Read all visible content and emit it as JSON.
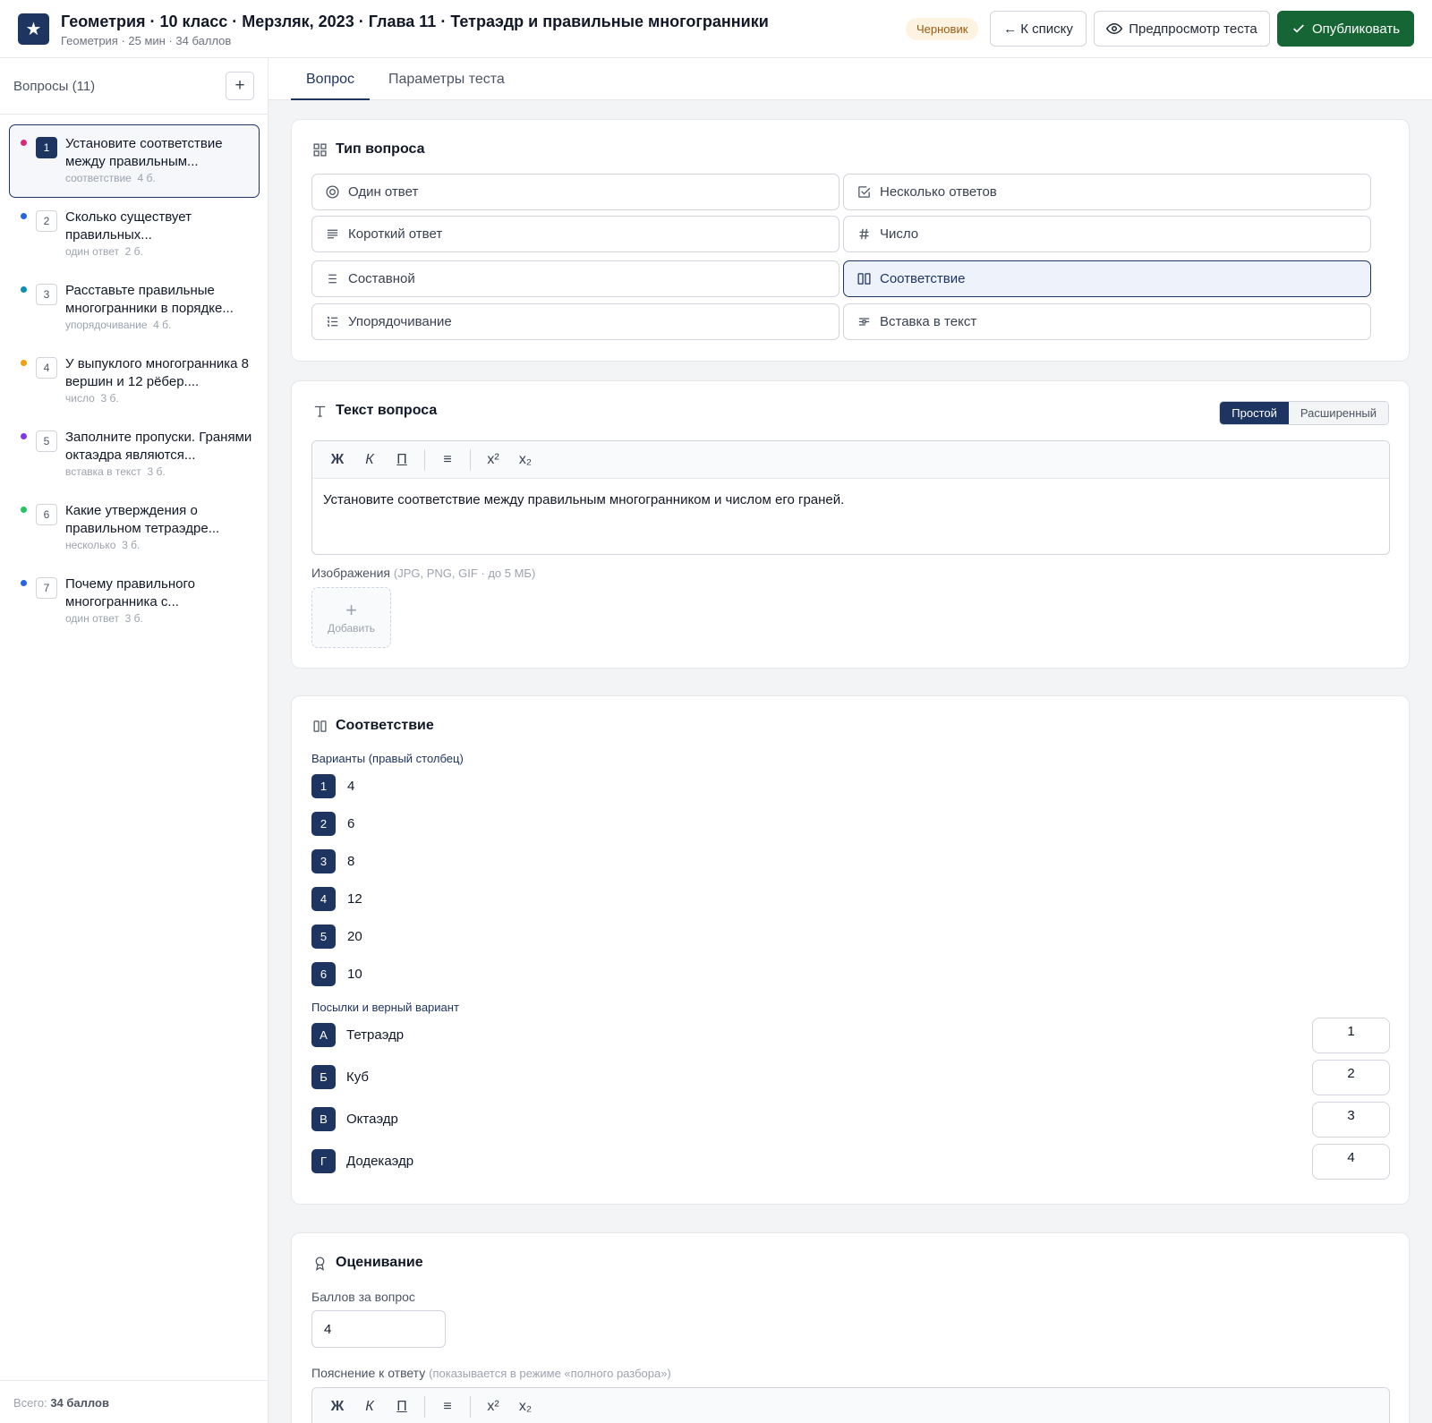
{
  "header": {
    "logo_glyph": "★",
    "title": "Геометрия · 10 класс · Мерзляк, 2023 · Глава 11 · Тетраэдр и правильные многогранники",
    "subtitle": "Геометрия · 25 мин · 34 баллов",
    "status_badge": "Черновик",
    "back_button": "← К списку",
    "preview_button": "Предпросмотр теста",
    "publish_button": "Опубликовать"
  },
  "sidebar": {
    "title": "Вопросы (11)",
    "add_glyph": "+",
    "items": [
      {
        "num": "1",
        "text": "Установите соответствие между правильным...",
        "type": "соответствие",
        "points": "4 б.",
        "dot_color": "#db2777",
        "active": true
      },
      {
        "num": "2",
        "text": "Сколько существует правильных...",
        "type": "один ответ",
        "points": "2 б.",
        "dot_color": "#2563eb",
        "active": false
      },
      {
        "num": "3",
        "text": "Расставьте правильные многогранники в порядке...",
        "type": "упорядочивание",
        "points": "4 б.",
        "dot_color": "#0891b2",
        "active": false
      },
      {
        "num": "4",
        "text": "У выпуклого многогранника 8 вершин и 12 рёбер....",
        "type": "число",
        "points": "3 б.",
        "dot_color": "#f59e0b",
        "active": false
      },
      {
        "num": "5",
        "text": "Заполните пропуски. Гранями октаэдра являются...",
        "type": "вставка в текст",
        "points": "3 б.",
        "dot_color": "#7c3aed",
        "active": false
      },
      {
        "num": "6",
        "text": "Какие утверждения о правильном тетраэдре...",
        "type": "несколько",
        "points": "3 б.",
        "dot_color": "#22c55e",
        "active": false
      },
      {
        "num": "7",
        "text": "Почему правильного многогранника с...",
        "type": "один ответ",
        "points": "3 б.",
        "dot_color": "#2563eb",
        "active": false
      }
    ],
    "total_prefix": "Всего:",
    "total_value": "34 баллов"
  },
  "tabs": [
    {
      "label": "Вопрос",
      "active": true
    },
    {
      "label": "Параметры теста",
      "active": false
    }
  ],
  "question_type": {
    "title": "Тип вопроса",
    "options": [
      {
        "label": "Один ответ",
        "icon": "radio-icon",
        "selected": false
      },
      {
        "label": "Несколько ответов",
        "icon": "checkbox-icon",
        "selected": false
      },
      {
        "label": "Короткий ответ",
        "icon": "lines-icon",
        "selected": false
      },
      {
        "label": "Число",
        "icon": "hash-icon",
        "selected": false
      },
      {
        "label": "Составной",
        "icon": "list-icon",
        "selected": false
      },
      {
        "label": "Соответствие",
        "icon": "columns-icon",
        "selected": true
      },
      {
        "label": "Упорядочивание",
        "icon": "ordered-list-icon",
        "selected": false
      },
      {
        "label": "Вставка в текст",
        "icon": "text-insert-icon",
        "selected": false
      }
    ]
  },
  "question_text": {
    "title": "Текст вопроса",
    "mode_simple": "Простой",
    "mode_advanced": "Расширенный",
    "toolbar": {
      "bold": "Ж",
      "italic": "К",
      "underline": "П",
      "list": "≡",
      "sup": "x²",
      "sub": "x₂"
    },
    "content": "Установите соответствие между правильным многогранником и числом его граней.",
    "images_label": "Изображения",
    "images_hint": "(JPG, PNG, GIF · до 5 МБ)",
    "add_plus": "+",
    "add_image": "Добавить"
  },
  "matching": {
    "title": "Соответствие",
    "options_label": "Варианты (правый столбец)",
    "options": [
      {
        "num": "1",
        "value": "4"
      },
      {
        "num": "2",
        "value": "6"
      },
      {
        "num": "3",
        "value": "8"
      },
      {
        "num": "4",
        "value": "12"
      },
      {
        "num": "5",
        "value": "20"
      },
      {
        "num": "6",
        "value": "10"
      }
    ],
    "premises_label": "Посылки и верный вариант",
    "premises": [
      {
        "letter": "А",
        "name": "Тетраэдр",
        "answer": "1"
      },
      {
        "letter": "Б",
        "name": "Куб",
        "answer": "2"
      },
      {
        "letter": "В",
        "name": "Октаэдр",
        "answer": "3"
      },
      {
        "letter": "Г",
        "name": "Додекаэдр",
        "answer": "4"
      }
    ]
  },
  "grading": {
    "title": "Оценивание",
    "points_label": "Баллов за вопрос",
    "points_value": "4",
    "explanation_label": "Пояснение к ответу",
    "explanation_hint": "(показывается в режиме «полного разбора»)",
    "toolbar": {
      "bold": "Ж",
      "italic": "К",
      "underline": "П",
      "list": "≡",
      "sup": "x²",
      "sub": "x₂"
    }
  },
  "colors": {
    "accent": "#1e3461",
    "publish": "#166534",
    "draft_bg": "#fdf3e0"
  }
}
